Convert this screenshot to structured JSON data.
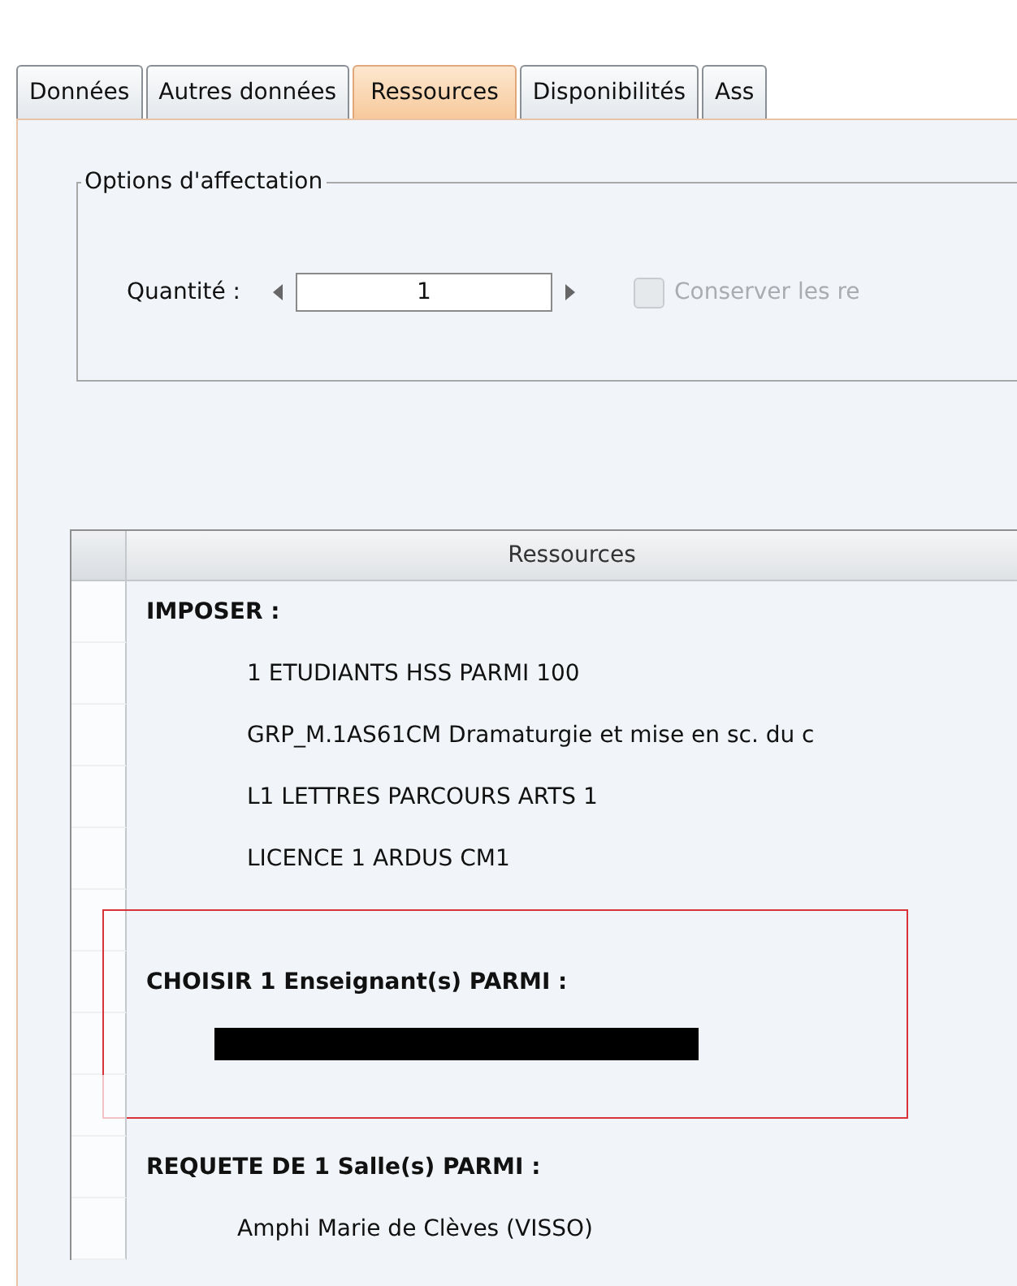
{
  "tabs": [
    {
      "label": "Données",
      "selected": false
    },
    {
      "label": "Autres données",
      "selected": false
    },
    {
      "label": "Ressources",
      "selected": true
    },
    {
      "label": "Disponibilités",
      "selected": false
    },
    {
      "label": "Ass",
      "selected": false
    }
  ],
  "options_group": {
    "title": "Options d'affectation",
    "quantity_label": "Quantité :",
    "quantity_value": "1",
    "checkbox": {
      "label": "Conserver les re",
      "checked": false,
      "disabled": true
    }
  },
  "table": {
    "columns": [
      "Ressources"
    ],
    "sections": [
      {
        "title": "IMPOSER :",
        "highlighted": false,
        "items": [
          {
            "kind": "text",
            "text": "1 ETUDIANTS HSS PARMI 100"
          },
          {
            "kind": "text",
            "text": "GRP_M.1AS61CM Dramaturgie et mise en sc. du c"
          },
          {
            "kind": "text",
            "text": "L1 LETTRES PARCOURS ARTS 1"
          },
          {
            "kind": "text",
            "text": "LICENCE 1 ARDUS CM1"
          }
        ]
      },
      {
        "title": "CHOISIR 1 Enseignant(s) PARMI :",
        "highlighted": true,
        "items": [
          {
            "kind": "redacted"
          }
        ]
      },
      {
        "title": "REQUETE DE 1 Salle(s) PARMI :",
        "highlighted": false,
        "items": [
          {
            "kind": "text",
            "text": "Amphi Marie de Clèves (VISSO)"
          }
        ]
      }
    ]
  }
}
